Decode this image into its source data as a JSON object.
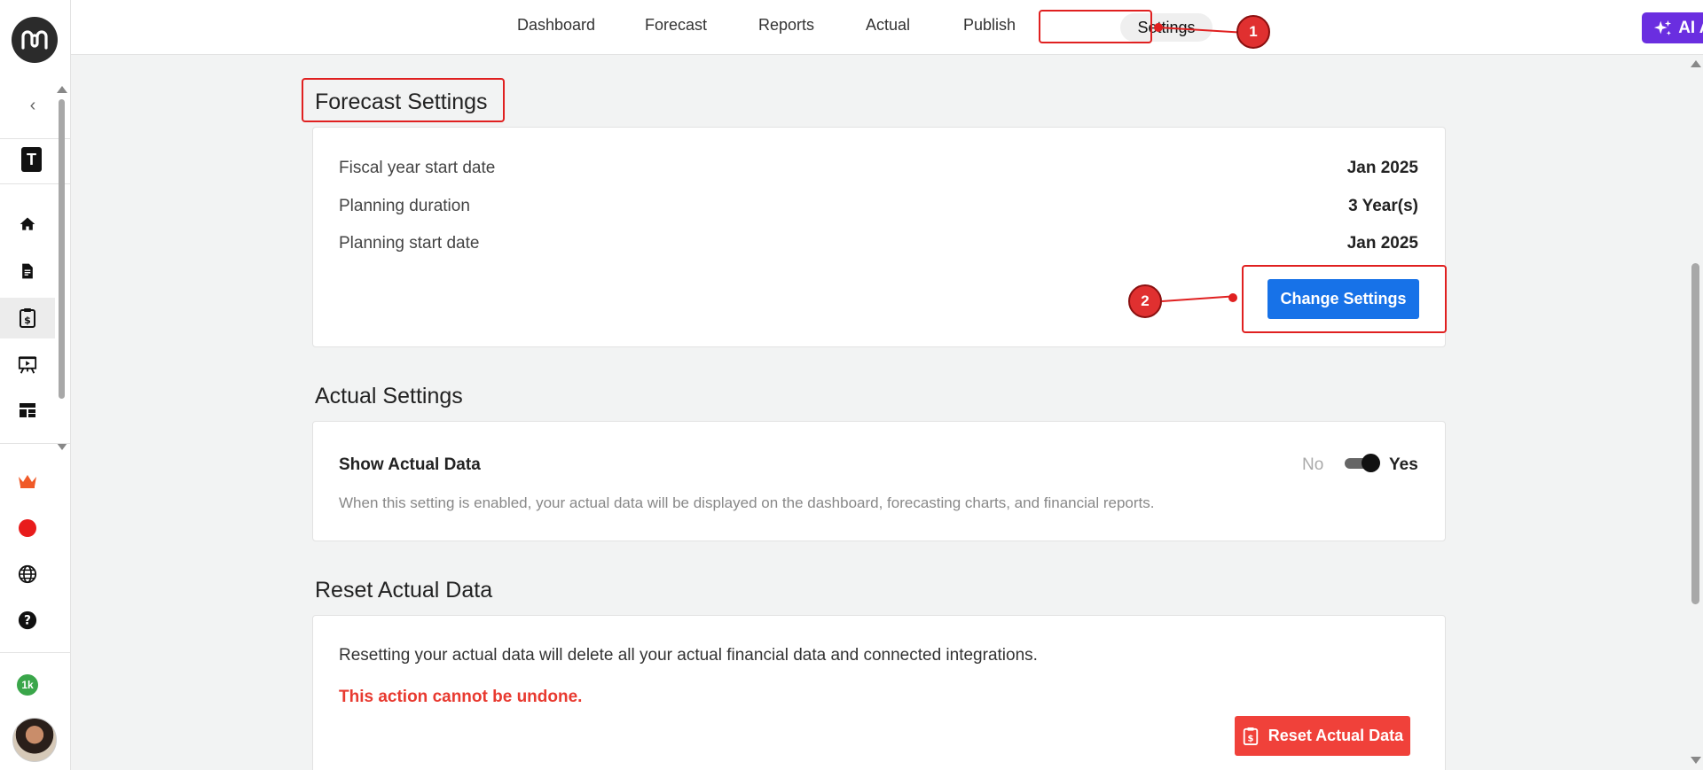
{
  "sidebar": {
    "workspace_badge": "T",
    "collapse_icon": "‹",
    "items": [
      {
        "name": "home-icon"
      },
      {
        "name": "document-icon"
      },
      {
        "name": "dollar-clipboard-icon",
        "active": true
      },
      {
        "name": "presentation-icon"
      },
      {
        "name": "dashboard-icon"
      }
    ],
    "lower_icons": [
      "crown-icon",
      "record-icon",
      "globe-icon",
      "help-icon"
    ],
    "notification_count": "1k"
  },
  "nav": {
    "items": [
      "Dashboard",
      "Forecast",
      "Reports",
      "Actual",
      "Publish"
    ],
    "active": "Settings",
    "ai_assist": "AI Assist"
  },
  "annotations": {
    "one": "1",
    "two": "2"
  },
  "forecast": {
    "title": "Forecast Settings",
    "rows": [
      {
        "label": "Fiscal year start date",
        "value": "Jan 2025"
      },
      {
        "label": "Planning duration",
        "value": "3 Year(s)"
      },
      {
        "label": "Planning start date",
        "value": "Jan 2025"
      }
    ],
    "button": "Change Settings"
  },
  "actual": {
    "title": "Actual Settings",
    "label": "Show Actual Data",
    "toggle_off": "No",
    "toggle_on": "Yes",
    "toggle_value": true,
    "description": "When this setting is enabled, your actual data will be displayed on the dashboard, forecasting charts, and financial reports."
  },
  "reset": {
    "title": "Reset Actual Data",
    "description": "Resetting your actual data will delete all your actual financial data and connected integrations.",
    "warning": "This action cannot be undone.",
    "button": "Reset Actual Data"
  },
  "colors": {
    "accent_blue": "#1772e8",
    "ai_purple": "#6a2ee0",
    "danger_red": "#f0413a",
    "annotation_red": "#e02020"
  }
}
